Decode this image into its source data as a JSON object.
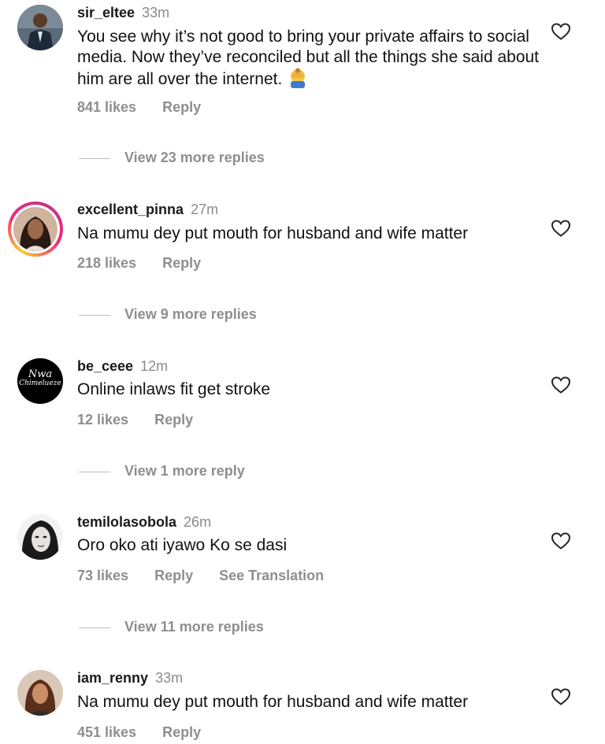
{
  "comments": [
    {
      "username": "sir_eltee",
      "time": "33m",
      "text": "You see why it’s not good to bring your private affairs to social media. Now they’ve reconciled but all the things she said about him are all over the internet.",
      "emoji_icon": "facepalm-emoji",
      "likes": "841 likes",
      "reply": "Reply",
      "view_replies": "View 23 more replies"
    },
    {
      "username": "excellent_pinna",
      "time": "27m",
      "text": "Na mumu dey put mouth for husband and wife matter",
      "likes": "218 likes",
      "reply": "Reply",
      "view_replies": "View 9 more replies"
    },
    {
      "username": "be_ceee",
      "time": "12m",
      "avatar_text": [
        "Nwa",
        "Chimelueze"
      ],
      "text": "Online inlaws fit get stroke",
      "likes": "12 likes",
      "reply": "Reply",
      "view_replies": "View 1 more reply"
    },
    {
      "username": "temilolasobola",
      "time": "26m",
      "text": "Oro oko ati iyawo Ko se dasi",
      "likes": "73 likes",
      "reply": "Reply",
      "translate": "See Translation",
      "view_replies": "View 11 more replies"
    },
    {
      "username": "iam_renny",
      "time": "33m",
      "text": "Na mumu dey put mouth for husband and wife matter",
      "likes": "451 likes",
      "reply": "Reply"
    }
  ],
  "icons": {
    "like": "heart-outline-icon"
  },
  "colors": {
    "muted": "#8e8e8e",
    "story_ring": "#ee2a7b"
  }
}
